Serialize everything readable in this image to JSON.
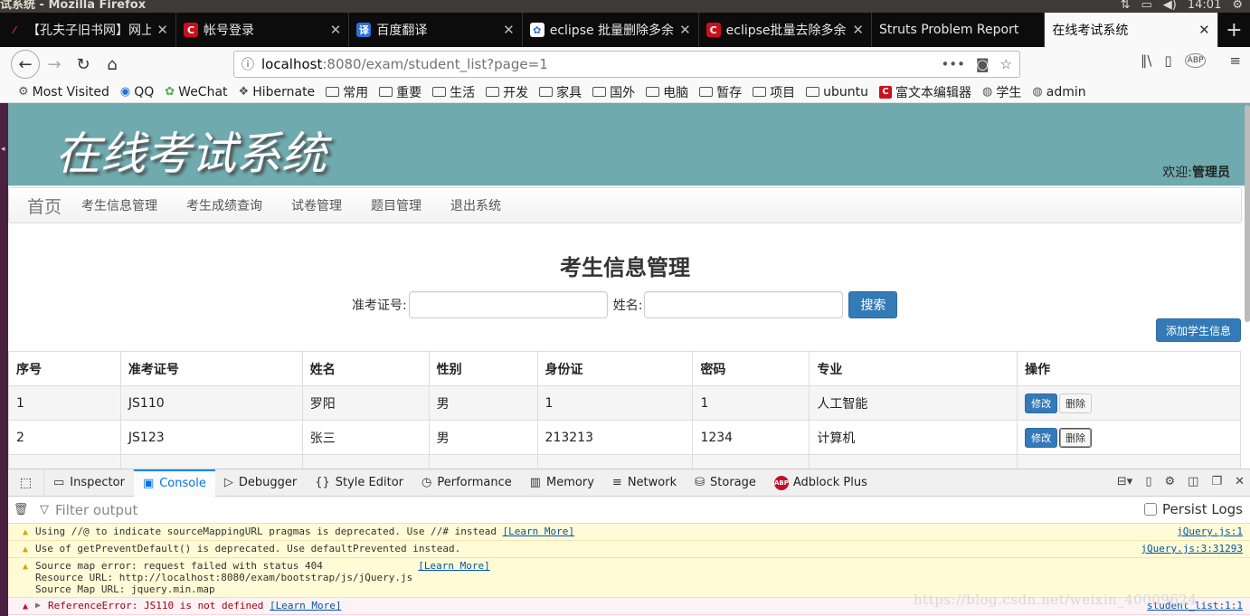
{
  "os": {
    "title": "试系统 - Mozilla Firefox",
    "time": "14:01"
  },
  "tabs": [
    {
      "label": "【孔夫子旧书网】网上",
      "icon": "kongfuzi-icon",
      "color": "#c33"
    },
    {
      "label": "帐号登录",
      "icon": "csdn-c-icon",
      "color": "#c9111b"
    },
    {
      "label": "百度翻译",
      "icon": "baidu-translate-icon",
      "color": "#2f6fd8"
    },
    {
      "label": "eclipse 批量删除多余",
      "icon": "baidu-paw-icon",
      "color": "#2f6fd8"
    },
    {
      "label": "eclipse批量去除多余",
      "icon": "csdn-c-icon",
      "color": "#c9111b"
    },
    {
      "label": "Struts Problem Report",
      "icon": "",
      "color": ""
    },
    {
      "label": "在线考试系统",
      "icon": "",
      "color": "",
      "active": true
    }
  ],
  "url": {
    "host": "localhost",
    "path": ":8080/exam/student_list?page=1"
  },
  "bookmarks": [
    {
      "label": "Most Visited",
      "icon": "gear-icon"
    },
    {
      "label": "QQ",
      "icon": "qq-icon"
    },
    {
      "label": "WeChat",
      "icon": "wechat-icon"
    },
    {
      "label": "Hibernate",
      "icon": "hibernate-icon"
    },
    {
      "label": "常用",
      "icon": "folder-icon"
    },
    {
      "label": "重要",
      "icon": "folder-icon"
    },
    {
      "label": "生活",
      "icon": "folder-icon"
    },
    {
      "label": "开发",
      "icon": "folder-icon"
    },
    {
      "label": "家具",
      "icon": "folder-icon"
    },
    {
      "label": "国外",
      "icon": "folder-icon"
    },
    {
      "label": "电脑",
      "icon": "folder-icon"
    },
    {
      "label": "暂存",
      "icon": "folder-icon"
    },
    {
      "label": "项目",
      "icon": "folder-icon"
    },
    {
      "label": "ubuntu",
      "icon": "folder-icon"
    },
    {
      "label": "富文本编辑器",
      "icon": "csdn-c-icon"
    },
    {
      "label": "学生",
      "icon": "globe-icon"
    },
    {
      "label": "admin",
      "icon": "globe-icon"
    }
  ],
  "site": {
    "logo": "在线考试系统",
    "welcome_prefix": "欢迎:",
    "welcome_user": "管理员",
    "brand": "首页",
    "menu": [
      "考生信息管理",
      "考生成绩查询",
      "试卷管理",
      "题目管理",
      "退出系统"
    ]
  },
  "main": {
    "title": "考生信息管理",
    "search": {
      "id_label": "准考证号:",
      "name_label": "姓名:",
      "button": "搜索",
      "id_value": "",
      "name_value": ""
    },
    "add_button": "添加学生信息",
    "table": {
      "headers": [
        "序号",
        "准考证号",
        "姓名",
        "性别",
        "身份证",
        "密码",
        "专业",
        "操作"
      ],
      "rows": [
        [
          "1",
          "JS110",
          "罗阳",
          "男",
          "1",
          "1",
          "人工智能"
        ],
        [
          "2",
          "JS123",
          "张三",
          "男",
          "213213",
          "1234",
          "计算机"
        ]
      ],
      "edit_label": "修改",
      "delete_label": "删除"
    }
  },
  "devtools": {
    "tabs": [
      "Inspector",
      "Console",
      "Debugger",
      "Style Editor",
      "Performance",
      "Memory",
      "Network",
      "Storage",
      "Adblock Plus"
    ],
    "active_tab": "Console",
    "filter_placeholder": "Filter output",
    "persist_label": "Persist Logs",
    "messages": [
      {
        "type": "warning",
        "text": "Using //@ to indicate sourceMappingURL pragmas is deprecated. Use //# instead",
        "link": "[Learn More]",
        "source": "jQuery.js:1"
      },
      {
        "type": "warning",
        "text": "Use of getPreventDefault() is deprecated.  Use defaultPrevented instead.",
        "link": "",
        "source": "jQuery.js:3:31293"
      },
      {
        "type": "warning",
        "lines": [
          "Source map error: request failed with status 404",
          "Resource URL: http://localhost:8080/exam/bootstrap/js/jQuery.js",
          "Source Map URL: jquery.min.map"
        ],
        "link": "[Learn More]",
        "source": ""
      },
      {
        "type": "error",
        "text": "ReferenceError: JS110 is not defined",
        "link": "[Learn More]",
        "source": "student_list:1:1"
      }
    ]
  },
  "watermark": "https://blog.csdn.net/weixin_40009624",
  "colors": {
    "header_bg": "#6eaaae",
    "primary": "#337ab7",
    "devtools_active": "#0a84ff"
  }
}
